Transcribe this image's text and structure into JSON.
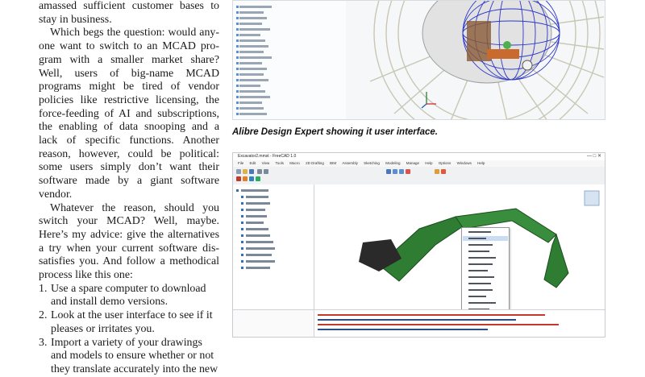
{
  "article": {
    "para1": "amassed sufficient customer bases to stay in business.",
    "para2": "Which begs the question: would any-one want to switch to an MCAD pro-gram with a smaller market share? Well, users of big-name MCAD programs might be tired of vendor policies like restrictive licensing, the force-feeding of AI and subscriptions, the enabling of data snooping and a lack of specific functions. Another reason, however, could be political: some users simply don’t want their software made by a giant software vendor.",
    "para3": "Whatever the reason, should you switch your MCAD? Well, maybe. Here’s my advice: give the alternatives a try when your current software dis-satisfies you. And follow a methodical process like this one:",
    "list": [
      {
        "num": "1.",
        "text": "Use a spare computer to download and install demo versions."
      },
      {
        "num": "2.",
        "text": "Look at the user interface to see if it pleases or irritates you."
      },
      {
        "num": "3.",
        "text": "Import a variety of your drawings and models to ensure whether or not they translate accurately into the new"
      }
    ]
  },
  "figure1": {
    "caption": "Alibre Design Expert showing it user interface.",
    "colors": {
      "wire": "#2f37c9",
      "rim": "#d3d3c4",
      "accent": "#c96a2e",
      "green": "#4caf50"
    }
  },
  "figure2": {
    "window_title": "Excavator2.mmst - FreeCAD 1.0",
    "menu": [
      "File",
      "Edit",
      "View",
      "Tools",
      "Macro",
      "2D Drafting",
      "BIM",
      "Assembly",
      "Sketching",
      "Modeling",
      "Manage",
      "Help",
      "Options",
      "Windows",
      "Help"
    ],
    "colors": {
      "arm": "#2e7d32",
      "body": "#2a2a2a",
      "highlight": "#e53935",
      "selection": "#c9dcf3"
    }
  }
}
